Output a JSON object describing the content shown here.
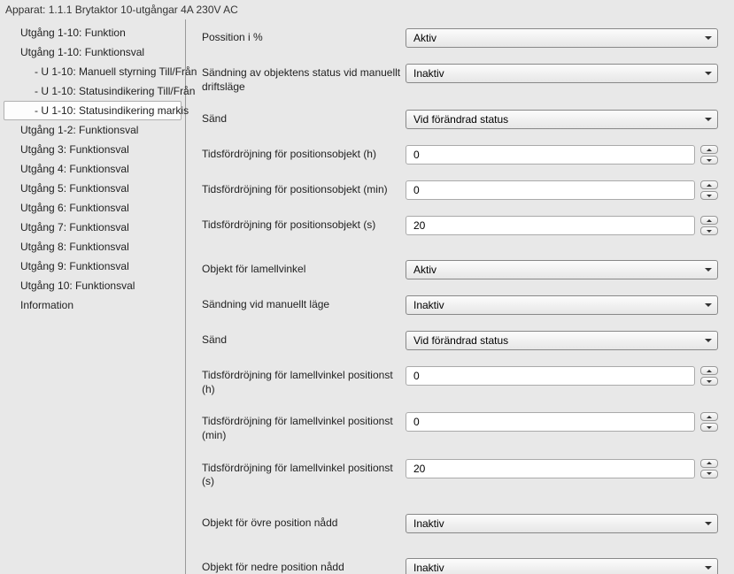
{
  "header": {
    "title": "Apparat: 1.1.1  Brytaktor 10-utgångar 4A 230V AC"
  },
  "sidebar": {
    "items": [
      {
        "label": "Utgång 1-10: Funktion",
        "sub": false,
        "selected": false
      },
      {
        "label": "Utgång 1-10: Funktionsval",
        "sub": false,
        "selected": false
      },
      {
        "label": "- U 1-10: Manuell styrning Till/Från",
        "sub": true,
        "selected": false
      },
      {
        "label": "- U 1-10: Statusindikering Till/Från",
        "sub": true,
        "selected": false
      },
      {
        "label": "- U 1-10: Statusindikering markis",
        "sub": true,
        "selected": true
      },
      {
        "label": "Utgång 1-2: Funktionsval",
        "sub": false,
        "selected": false
      },
      {
        "label": "Utgång 3: Funktionsval",
        "sub": false,
        "selected": false
      },
      {
        "label": "Utgång 4: Funktionsval",
        "sub": false,
        "selected": false
      },
      {
        "label": "Utgång 5: Funktionsval",
        "sub": false,
        "selected": false
      },
      {
        "label": "Utgång 6: Funktionsval",
        "sub": false,
        "selected": false
      },
      {
        "label": "Utgång 7: Funktionsval",
        "sub": false,
        "selected": false
      },
      {
        "label": "Utgång 8: Funktionsval",
        "sub": false,
        "selected": false
      },
      {
        "label": "Utgång 9: Funktionsval",
        "sub": false,
        "selected": false
      },
      {
        "label": "Utgång 10: Funktionsval",
        "sub": false,
        "selected": false
      },
      {
        "label": "Information",
        "sub": false,
        "selected": false
      }
    ]
  },
  "form": {
    "rows": [
      {
        "label": "Possition i %",
        "type": "dropdown",
        "value": "Aktiv",
        "gap": false
      },
      {
        "label": "Sändning av objektens status vid manuellt driftsläge",
        "type": "dropdown",
        "value": "Inaktiv",
        "gap": false
      },
      {
        "label": "Sänd",
        "type": "dropdown",
        "value": "Vid förändrad status",
        "gap": false
      },
      {
        "label": "Tidsfördröjning för positionsobjekt (h)",
        "type": "number",
        "value": "0",
        "gap": false
      },
      {
        "label": "Tidsfördröjning för positionsobjekt (min)",
        "type": "number",
        "value": "0",
        "gap": false
      },
      {
        "label": "Tidsfördröjning för positionsobjekt (s)",
        "type": "number",
        "value": "20",
        "gap": false
      },
      {
        "label": "Objekt för lamellvinkel",
        "type": "dropdown",
        "value": "Aktiv",
        "gap": true
      },
      {
        "label": "Sändning vid manuellt läge",
        "type": "dropdown",
        "value": "Inaktiv",
        "gap": false
      },
      {
        "label": "Sänd",
        "type": "dropdown",
        "value": "Vid förändrad status",
        "gap": false
      },
      {
        "label": "Tidsfördröjning för lamellvinkel positionst (h)",
        "type": "number",
        "value": "0",
        "gap": false
      },
      {
        "label": "Tidsfördröjning för lamellvinkel positionst (min)",
        "type": "number",
        "value": "0",
        "gap": false
      },
      {
        "label": "Tidsfördröjning för lamellvinkel positionst (s)",
        "type": "number",
        "value": "20",
        "gap": false
      },
      {
        "label": "Objekt för övre position nådd",
        "type": "dropdown",
        "value": "Inaktiv",
        "gap": true
      },
      {
        "label": "Objekt för nedre position nådd",
        "type": "dropdown",
        "value": "Inaktiv",
        "gap": true
      }
    ]
  }
}
